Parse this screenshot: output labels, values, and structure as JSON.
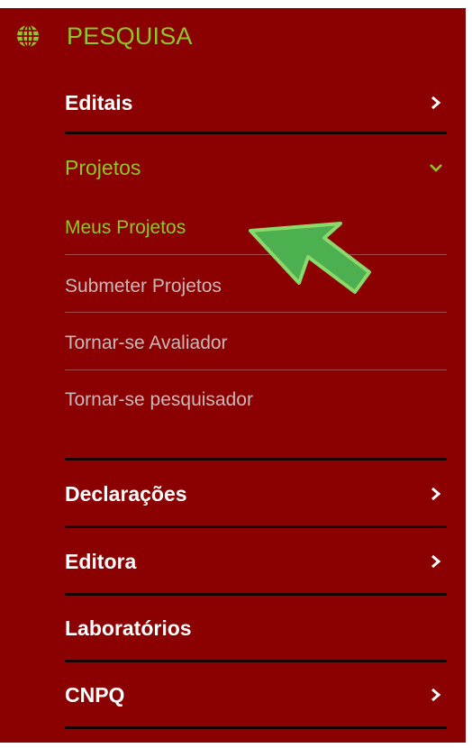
{
  "section": {
    "title": "PESQUISA",
    "icon": "globe-icon",
    "accent_color": "#8fc72b",
    "background_color": "#8b0000"
  },
  "menu": {
    "editais": "Editais",
    "projetos": "Projetos",
    "sub": {
      "meus_projetos": "Meus Projetos",
      "submeter_projetos": "Submeter Projetos",
      "tornar_avaliador": "Tornar-se Avaliador",
      "tornar_pesquisador": "Tornar-se pesquisador"
    },
    "declaracoes": "Declarações",
    "editora": "Editora",
    "laboratorios": "Laboratórios",
    "cnpq": "CNPQ"
  },
  "annotation": {
    "pointer_icon": "green-arrow-icon",
    "pointer_color": "#4caf50"
  }
}
